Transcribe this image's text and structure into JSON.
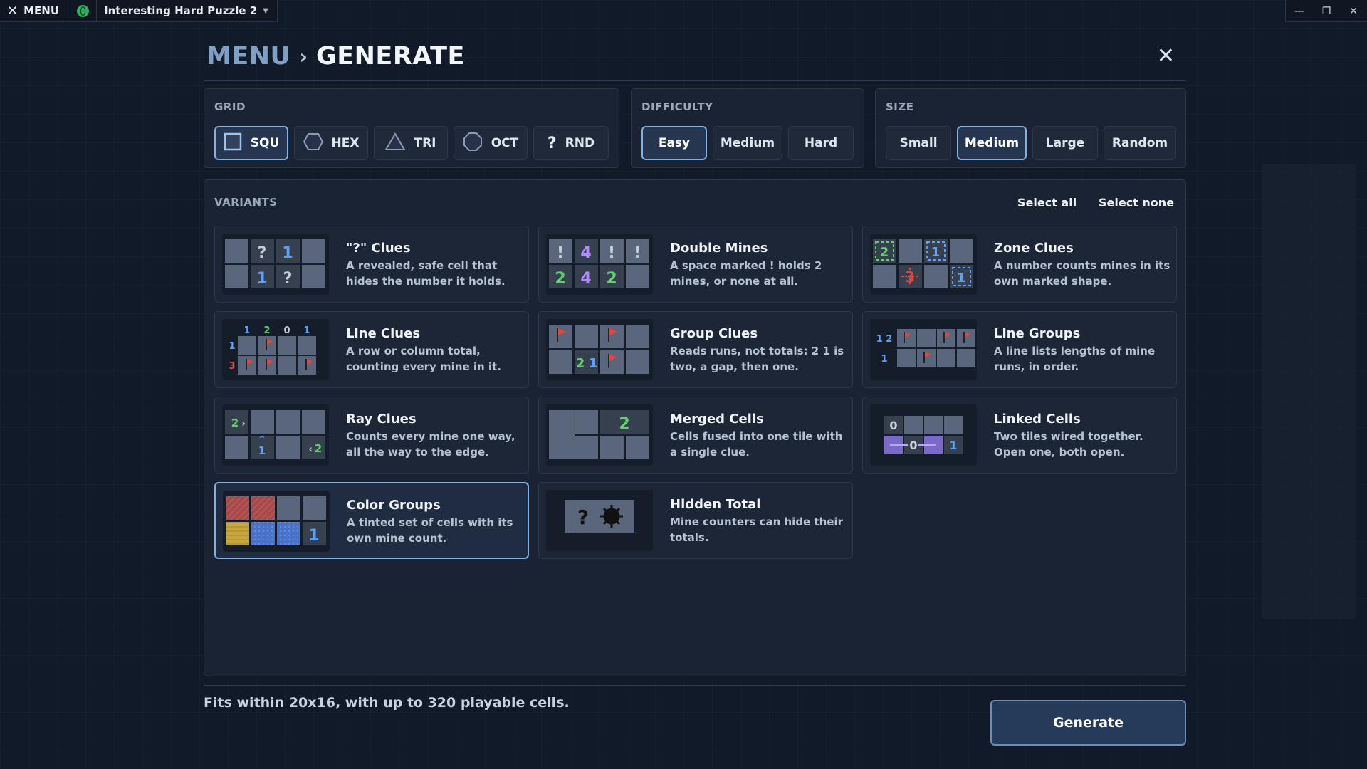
{
  "titlebar": {
    "menu_label": "MENU",
    "puzzle_name": "Interesting Hard Puzzle 2"
  },
  "header": {
    "breadcrumb_root": "MENU",
    "breadcrumb_current": "GENERATE"
  },
  "grid": {
    "label": "GRID",
    "options": [
      {
        "label": "SQU",
        "icon": "square-icon",
        "selected": true
      },
      {
        "label": "HEX",
        "icon": "hexagon-icon",
        "selected": false
      },
      {
        "label": "TRI",
        "icon": "triangle-icon",
        "selected": false
      },
      {
        "label": "OCT",
        "icon": "octagon-icon",
        "selected": false
      },
      {
        "label": "RND",
        "icon": "question-icon",
        "selected": false
      }
    ]
  },
  "difficulty": {
    "label": "DIFFICULTY",
    "options": [
      {
        "label": "Easy",
        "selected": true
      },
      {
        "label": "Medium",
        "selected": false
      },
      {
        "label": "Hard",
        "selected": false
      }
    ]
  },
  "size": {
    "label": "SIZE",
    "options": [
      {
        "label": "Small",
        "selected": false
      },
      {
        "label": "Medium",
        "selected": true
      },
      {
        "label": "Large",
        "selected": false
      },
      {
        "label": "Random",
        "selected": false
      }
    ]
  },
  "variants": {
    "label": "VARIANTS",
    "select_all": "Select all",
    "select_none": "Select none",
    "items": [
      {
        "title": "\"?\" Clues",
        "desc": "A revealed, safe cell that hides the number it holds.",
        "selected": false
      },
      {
        "title": "Double Mines",
        "desc": "A space marked ! holds 2 mines, or none at all.",
        "selected": false
      },
      {
        "title": "Zone Clues",
        "desc": "A number counts mines in its own marked shape.",
        "selected": false
      },
      {
        "title": "Line Clues",
        "desc": "A row or column total, counting every mine in it.",
        "selected": false
      },
      {
        "title": "Group Clues",
        "desc": "Reads runs, not totals: 2 1 is two, a gap, then one.",
        "selected": false
      },
      {
        "title": "Line Groups",
        "desc": "A line lists lengths of mine runs, in order.",
        "selected": false
      },
      {
        "title": "Ray Clues",
        "desc": "Counts every mine one way, all the way to the edge.",
        "selected": false
      },
      {
        "title": "Merged Cells",
        "desc": "Cells fused into one tile with a single clue.",
        "selected": false
      },
      {
        "title": "Linked Cells",
        "desc": "Two tiles wired together. Open one, both open.",
        "selected": false
      },
      {
        "title": "Color Groups",
        "desc": "A tinted set of cells with its own mine count.",
        "selected": true
      },
      {
        "title": "Hidden Total",
        "desc": "Mine counters can hide their totals.",
        "selected": false
      }
    ],
    "thumbs": {
      "q_clues": {
        "row1": [
          "?",
          "1"
        ],
        "row2": [
          "1",
          "?"
        ]
      },
      "double_mines": {
        "row1": [
          "!",
          "4",
          "!",
          "!"
        ],
        "row2": [
          "2",
          "4",
          "2"
        ]
      },
      "zone_clues": {
        "a": "2",
        "b": "1",
        "c": "3",
        "d": "1"
      },
      "line_clues": {
        "cols": [
          "1",
          "2",
          "0",
          "1"
        ],
        "rows": [
          "1",
          "3"
        ]
      },
      "group_clues": {
        "a": "2",
        "b": "1"
      },
      "line_groups": {
        "row1": "1 2",
        "row2": "1"
      },
      "ray_clues": {
        "a": "2",
        "b": "1",
        "c": "2"
      },
      "merged_cells": {
        "a": "2"
      },
      "linked_cells": {
        "a": "0",
        "b": "0",
        "c": "1"
      },
      "color_groups": {
        "a": "1"
      },
      "hidden_total": {
        "a": "?"
      }
    }
  },
  "footer": {
    "fits_text": "Fits within 20x16, with up to 320 playable cells.",
    "generate_label": "Generate"
  },
  "colors": {
    "accent": "#7fb2e4",
    "clue_blue": "#5aa0ff",
    "clue_green": "#5fd36a",
    "clue_purple": "#b08cff",
    "flag_red": "#e0453e"
  }
}
